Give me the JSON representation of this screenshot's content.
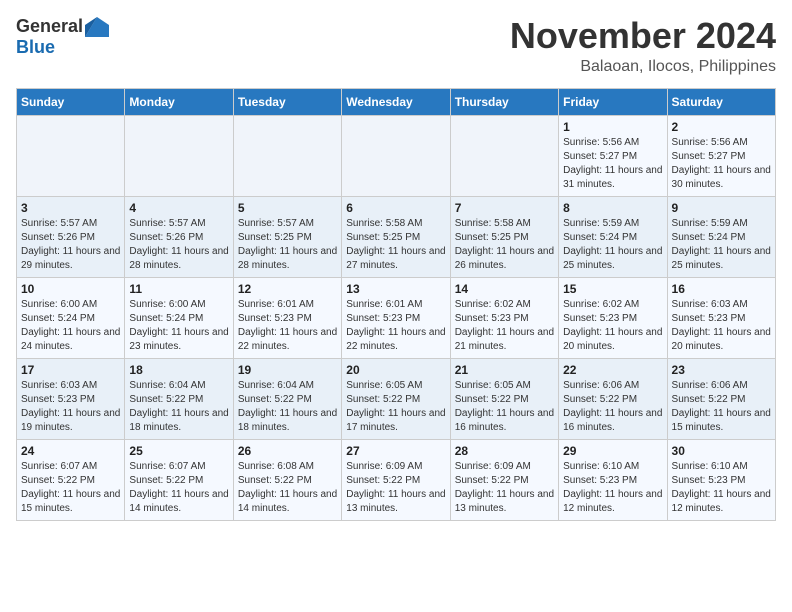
{
  "header": {
    "logo_general": "General",
    "logo_blue": "Blue",
    "month": "November 2024",
    "location": "Balaoan, Ilocos, Philippines"
  },
  "days_of_week": [
    "Sunday",
    "Monday",
    "Tuesday",
    "Wednesday",
    "Thursday",
    "Friday",
    "Saturday"
  ],
  "weeks": [
    [
      {
        "day": "",
        "info": ""
      },
      {
        "day": "",
        "info": ""
      },
      {
        "day": "",
        "info": ""
      },
      {
        "day": "",
        "info": ""
      },
      {
        "day": "",
        "info": ""
      },
      {
        "day": "1",
        "info": "Sunrise: 5:56 AM\nSunset: 5:27 PM\nDaylight: 11 hours and 31 minutes."
      },
      {
        "day": "2",
        "info": "Sunrise: 5:56 AM\nSunset: 5:27 PM\nDaylight: 11 hours and 30 minutes."
      }
    ],
    [
      {
        "day": "3",
        "info": "Sunrise: 5:57 AM\nSunset: 5:26 PM\nDaylight: 11 hours and 29 minutes."
      },
      {
        "day": "4",
        "info": "Sunrise: 5:57 AM\nSunset: 5:26 PM\nDaylight: 11 hours and 28 minutes."
      },
      {
        "day": "5",
        "info": "Sunrise: 5:57 AM\nSunset: 5:25 PM\nDaylight: 11 hours and 28 minutes."
      },
      {
        "day": "6",
        "info": "Sunrise: 5:58 AM\nSunset: 5:25 PM\nDaylight: 11 hours and 27 minutes."
      },
      {
        "day": "7",
        "info": "Sunrise: 5:58 AM\nSunset: 5:25 PM\nDaylight: 11 hours and 26 minutes."
      },
      {
        "day": "8",
        "info": "Sunrise: 5:59 AM\nSunset: 5:24 PM\nDaylight: 11 hours and 25 minutes."
      },
      {
        "day": "9",
        "info": "Sunrise: 5:59 AM\nSunset: 5:24 PM\nDaylight: 11 hours and 25 minutes."
      }
    ],
    [
      {
        "day": "10",
        "info": "Sunrise: 6:00 AM\nSunset: 5:24 PM\nDaylight: 11 hours and 24 minutes."
      },
      {
        "day": "11",
        "info": "Sunrise: 6:00 AM\nSunset: 5:24 PM\nDaylight: 11 hours and 23 minutes."
      },
      {
        "day": "12",
        "info": "Sunrise: 6:01 AM\nSunset: 5:23 PM\nDaylight: 11 hours and 22 minutes."
      },
      {
        "day": "13",
        "info": "Sunrise: 6:01 AM\nSunset: 5:23 PM\nDaylight: 11 hours and 22 minutes."
      },
      {
        "day": "14",
        "info": "Sunrise: 6:02 AM\nSunset: 5:23 PM\nDaylight: 11 hours and 21 minutes."
      },
      {
        "day": "15",
        "info": "Sunrise: 6:02 AM\nSunset: 5:23 PM\nDaylight: 11 hours and 20 minutes."
      },
      {
        "day": "16",
        "info": "Sunrise: 6:03 AM\nSunset: 5:23 PM\nDaylight: 11 hours and 20 minutes."
      }
    ],
    [
      {
        "day": "17",
        "info": "Sunrise: 6:03 AM\nSunset: 5:23 PM\nDaylight: 11 hours and 19 minutes."
      },
      {
        "day": "18",
        "info": "Sunrise: 6:04 AM\nSunset: 5:22 PM\nDaylight: 11 hours and 18 minutes."
      },
      {
        "day": "19",
        "info": "Sunrise: 6:04 AM\nSunset: 5:22 PM\nDaylight: 11 hours and 18 minutes."
      },
      {
        "day": "20",
        "info": "Sunrise: 6:05 AM\nSunset: 5:22 PM\nDaylight: 11 hours and 17 minutes."
      },
      {
        "day": "21",
        "info": "Sunrise: 6:05 AM\nSunset: 5:22 PM\nDaylight: 11 hours and 16 minutes."
      },
      {
        "day": "22",
        "info": "Sunrise: 6:06 AM\nSunset: 5:22 PM\nDaylight: 11 hours and 16 minutes."
      },
      {
        "day": "23",
        "info": "Sunrise: 6:06 AM\nSunset: 5:22 PM\nDaylight: 11 hours and 15 minutes."
      }
    ],
    [
      {
        "day": "24",
        "info": "Sunrise: 6:07 AM\nSunset: 5:22 PM\nDaylight: 11 hours and 15 minutes."
      },
      {
        "day": "25",
        "info": "Sunrise: 6:07 AM\nSunset: 5:22 PM\nDaylight: 11 hours and 14 minutes."
      },
      {
        "day": "26",
        "info": "Sunrise: 6:08 AM\nSunset: 5:22 PM\nDaylight: 11 hours and 14 minutes."
      },
      {
        "day": "27",
        "info": "Sunrise: 6:09 AM\nSunset: 5:22 PM\nDaylight: 11 hours and 13 minutes."
      },
      {
        "day": "28",
        "info": "Sunrise: 6:09 AM\nSunset: 5:22 PM\nDaylight: 11 hours and 13 minutes."
      },
      {
        "day": "29",
        "info": "Sunrise: 6:10 AM\nSunset: 5:23 PM\nDaylight: 11 hours and 12 minutes."
      },
      {
        "day": "30",
        "info": "Sunrise: 6:10 AM\nSunset: 5:23 PM\nDaylight: 11 hours and 12 minutes."
      }
    ]
  ]
}
